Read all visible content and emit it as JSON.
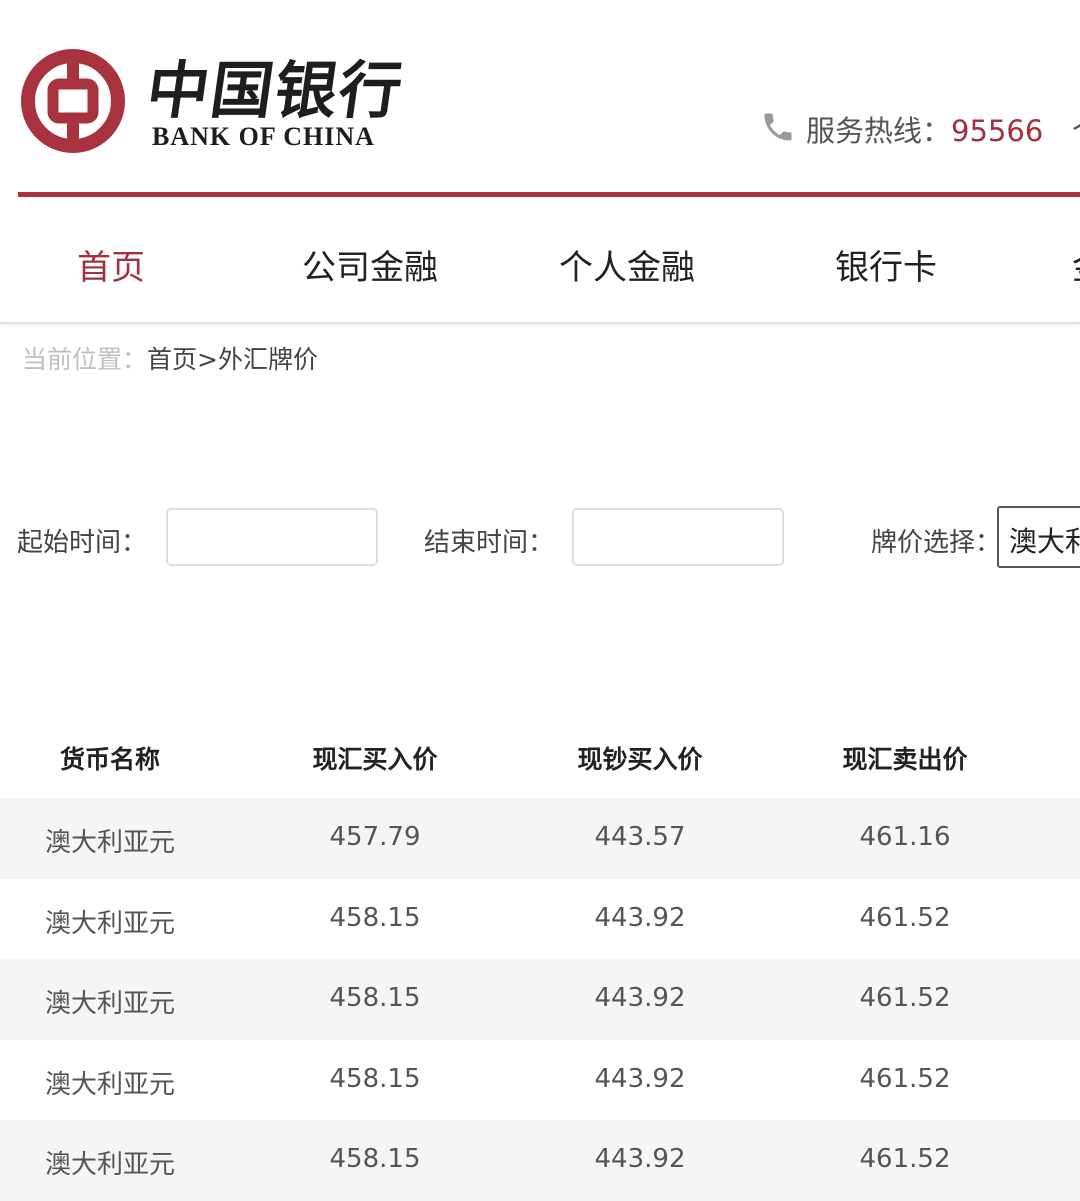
{
  "header": {
    "logo_cn": "中国银行",
    "logo_en": "BANK OF CHINA",
    "hotline_label": "服务热线：",
    "hotline_number": "95566",
    "hotline_trailing": "个",
    "brand_color": "#a8323e"
  },
  "nav": {
    "items": [
      {
        "label": "首页",
        "active": true
      },
      {
        "label": "公司金融",
        "active": false
      },
      {
        "label": "个人金融",
        "active": false
      },
      {
        "label": "银行卡",
        "active": false
      },
      {
        "label": "金",
        "active": false
      }
    ]
  },
  "breadcrumb": {
    "label": "当前位置：",
    "path": "首页>外汇牌价"
  },
  "filters": {
    "start_label": "起始时间：",
    "start_value": "",
    "end_label": "结束时间：",
    "end_value": "",
    "select_label": "牌价选择：",
    "select_value": "澳大利亚元"
  },
  "table": {
    "headers": [
      "货币名称",
      "现汇买入价",
      "现钞买入价",
      "现汇卖出价"
    ],
    "rows": [
      [
        "澳大利亚元",
        "457.79",
        "443.57",
        "461.16"
      ],
      [
        "澳大利亚元",
        "458.15",
        "443.92",
        "461.52"
      ],
      [
        "澳大利亚元",
        "458.15",
        "443.92",
        "461.52"
      ],
      [
        "澳大利亚元",
        "458.15",
        "443.92",
        "461.52"
      ],
      [
        "澳大利亚元",
        "458.15",
        "443.92",
        "461.52"
      ]
    ]
  },
  "icons": {
    "logo": "bank-of-china-emblem",
    "phone": "phone-icon"
  }
}
